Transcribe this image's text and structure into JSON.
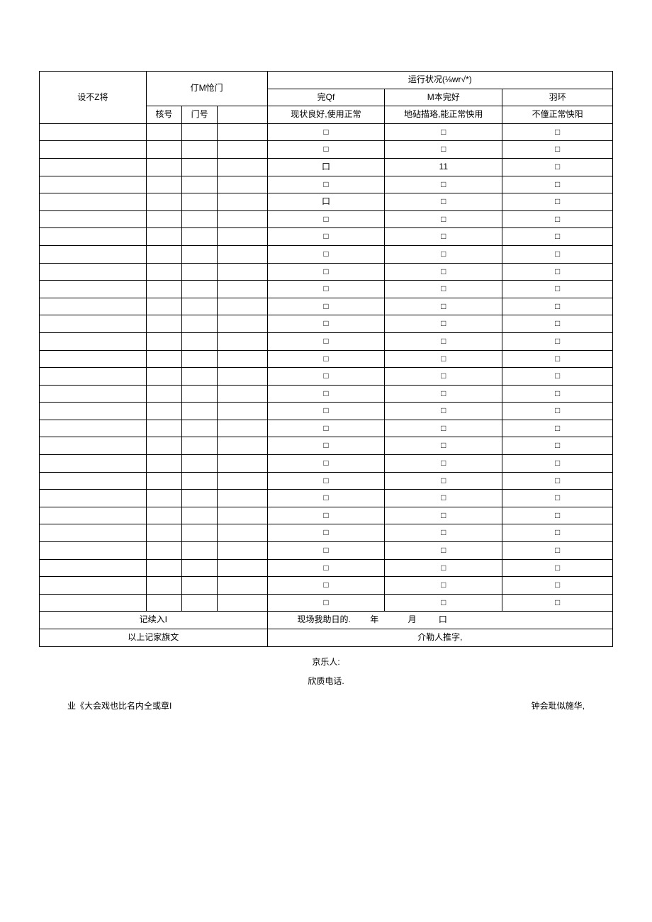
{
  "headers": {
    "equipName": "设不Z将",
    "gateGroup": "仃M怆门",
    "statusGroup": "运行状况(⅛wr√*)",
    "statusA": "完Qf",
    "statusB": "M本完好",
    "statusC": "羽环",
    "subGate1": "核号",
    "subGate2": "门号",
    "subGate3": "",
    "descA": "现状良好,使用正常",
    "descB": "地砧描珞,能正常怏用",
    "descC": "不僮正常怏阳"
  },
  "rows": [
    {
      "a": "□",
      "b": "□",
      "c": "□"
    },
    {
      "a": "□",
      "b": "□",
      "c": "□"
    },
    {
      "a": "口",
      "b": "11",
      "c": "□"
    },
    {
      "a": "□",
      "b": "□",
      "c": "□"
    },
    {
      "a": "口",
      "b": "□",
      "c": "□"
    },
    {
      "a": "□",
      "b": "□",
      "c": "□"
    },
    {
      "a": "□",
      "b": "□",
      "c": "□"
    },
    {
      "a": "□",
      "b": "□",
      "c": "□"
    },
    {
      "a": "□",
      "b": "□",
      "c": "□"
    },
    {
      "a": "□",
      "b": "□",
      "c": "□"
    },
    {
      "a": "□",
      "b": "□",
      "c": "□"
    },
    {
      "a": "□",
      "b": "□",
      "c": "□"
    },
    {
      "a": "□",
      "b": "□",
      "c": "□"
    },
    {
      "a": "□",
      "b": "□",
      "c": "□"
    },
    {
      "a": "□",
      "b": "□",
      "c": "□"
    },
    {
      "a": "□",
      "b": "□",
      "c": "□"
    },
    {
      "a": "□",
      "b": "□",
      "c": "□"
    },
    {
      "a": "□",
      "b": "□",
      "c": "□"
    },
    {
      "a": "□",
      "b": "□",
      "c": "□"
    },
    {
      "a": "□",
      "b": "□",
      "c": "□"
    },
    {
      "a": "□",
      "b": "□",
      "c": "□"
    },
    {
      "a": "□",
      "b": "□",
      "c": "□"
    },
    {
      "a": "□",
      "b": "□",
      "c": "□"
    },
    {
      "a": "□",
      "b": "□",
      "c": "□"
    },
    {
      "a": "□",
      "b": "□",
      "c": "□"
    },
    {
      "a": "□",
      "b": "□",
      "c": "□"
    },
    {
      "a": "□",
      "b": "□",
      "c": "□"
    },
    {
      "a": "□",
      "b": "□",
      "c": "□"
    }
  ],
  "footer": {
    "recorderLabel": "记续入I",
    "dateLabel": "现场我助日的.",
    "year": "年",
    "month": "月",
    "day": "口",
    "confirmLead": "以上记家旗文",
    "confirmSign": "介勒人推字,",
    "contact": "京乐人:",
    "phone": "欣质电话.",
    "stampLeft": "业《大会戏也比名内仝或章I",
    "stampRight": "钟会玭似施华,"
  }
}
